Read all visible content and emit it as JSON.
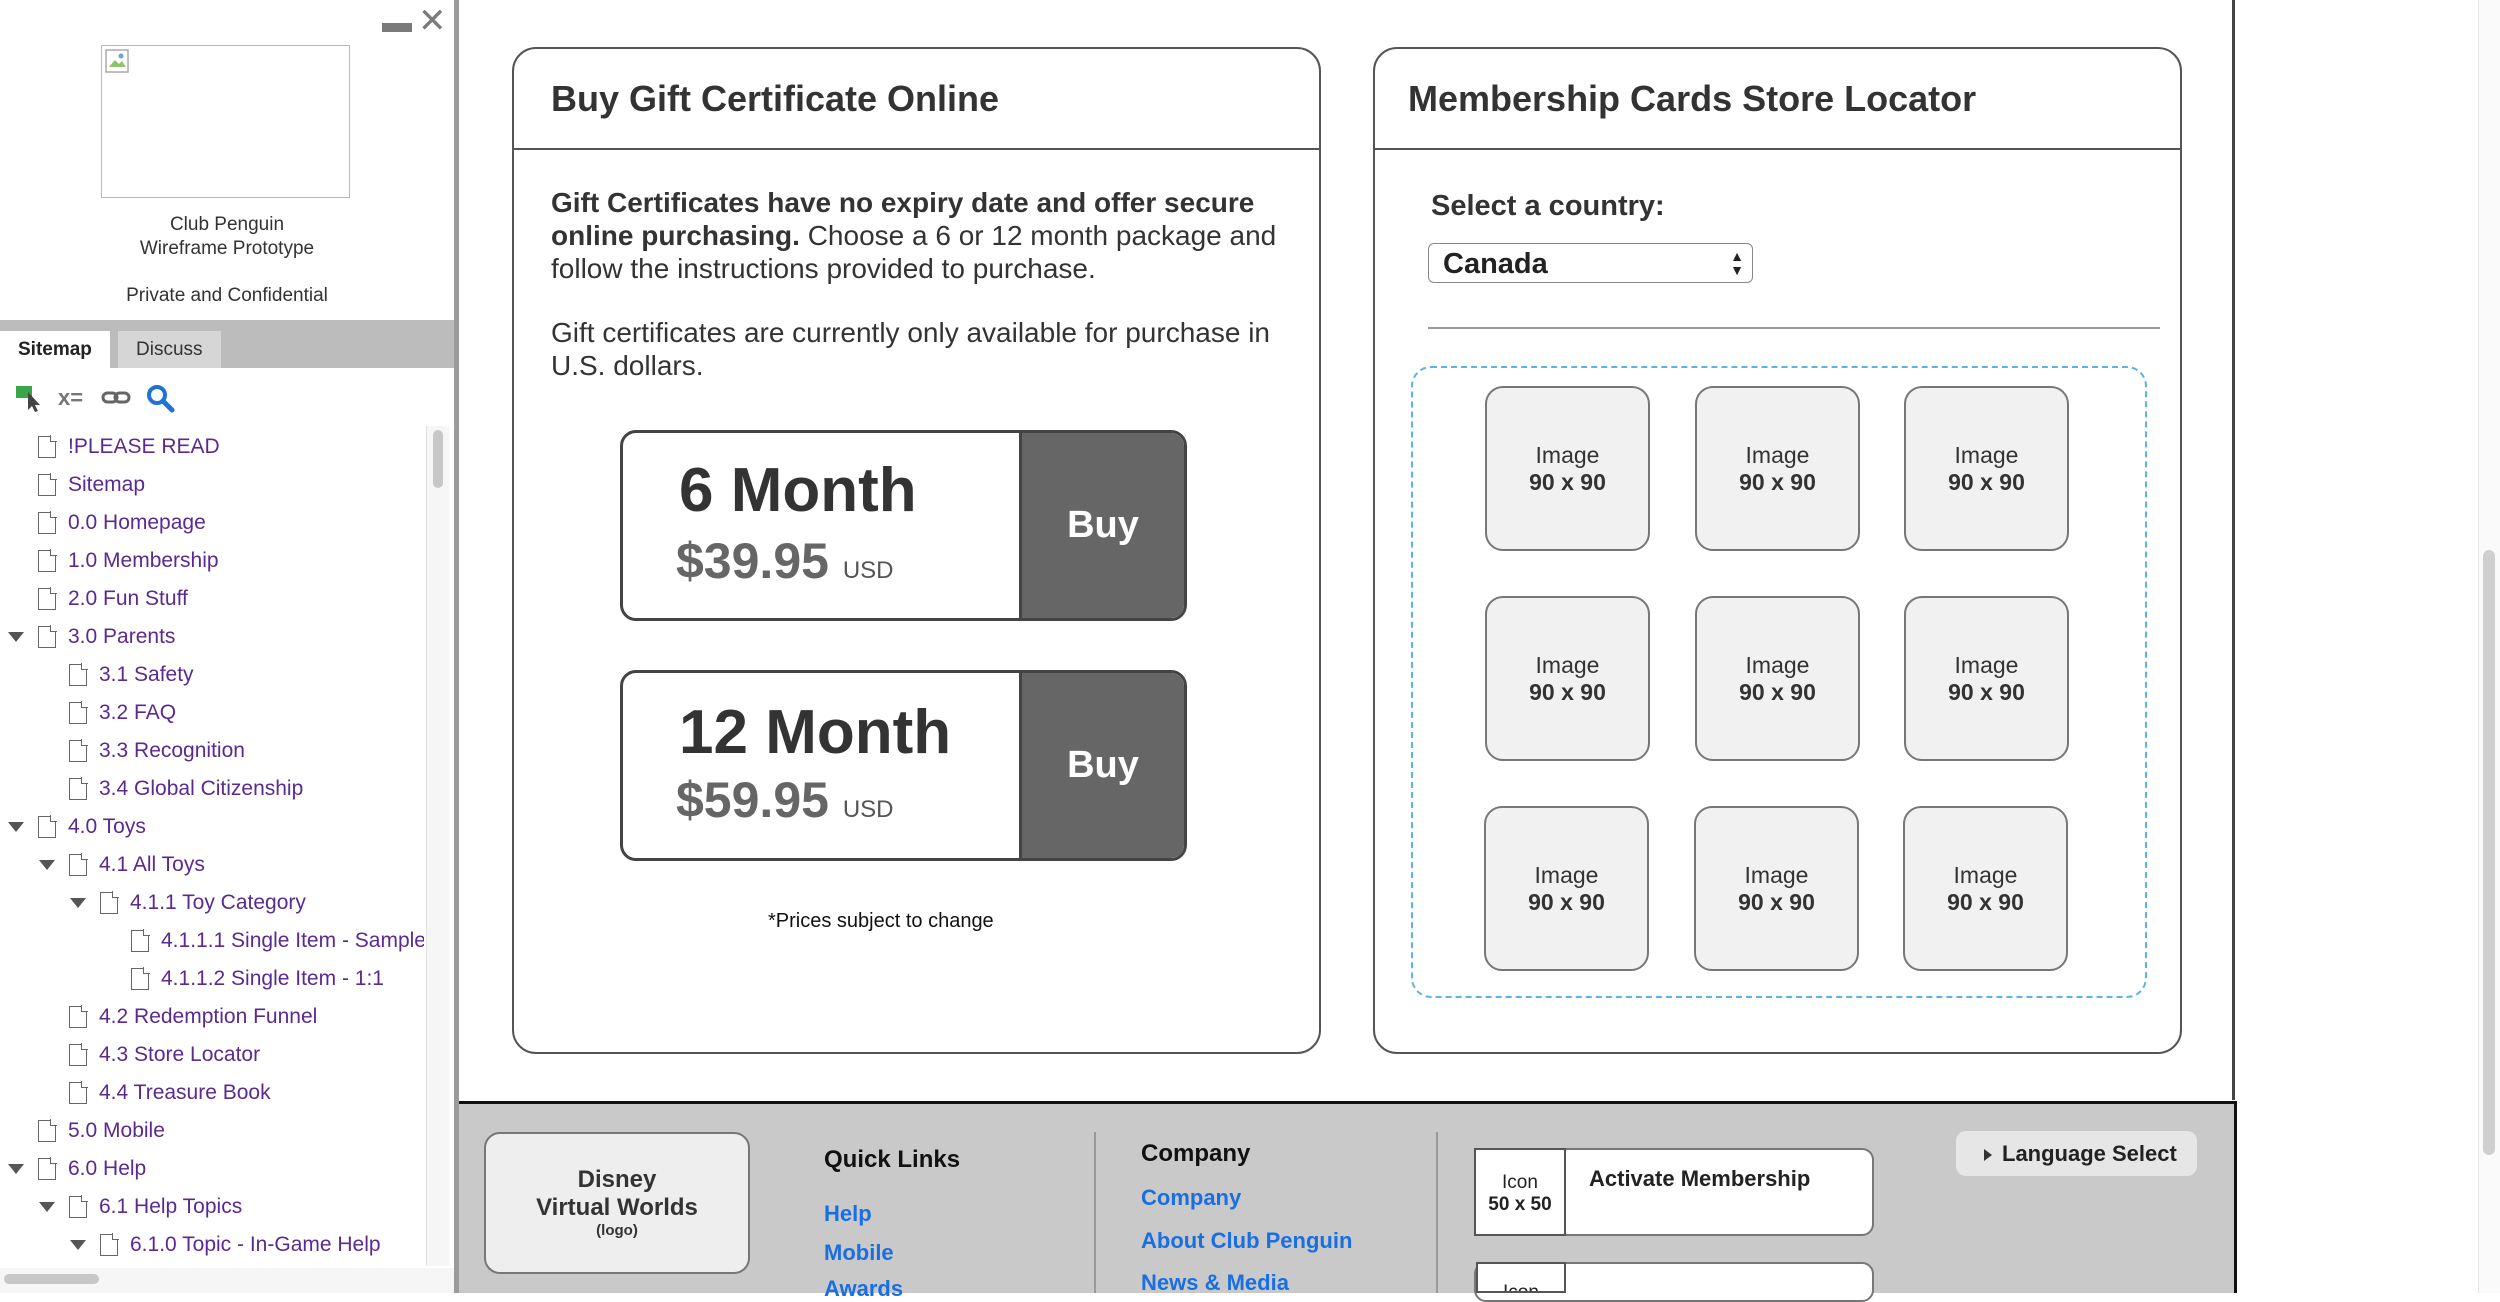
{
  "sidebar": {
    "caption": {
      "line1": "Club Penguin",
      "line2": "Wireframe Prototype",
      "line3": "Private and Confidential"
    },
    "tabs": {
      "sitemap": "Sitemap",
      "discuss": "Discuss"
    },
    "toolbar": {
      "vars_label": "x="
    },
    "tree": [
      {
        "label": "!PLEASE READ"
      },
      {
        "label": "Sitemap"
      },
      {
        "label": "0.0 Homepage"
      },
      {
        "label": "1.0 Membership"
      },
      {
        "label": "2.0 Fun Stuff"
      },
      {
        "label": "3.0 Parents"
      },
      {
        "label": "3.1 Safety"
      },
      {
        "label": "3.2 FAQ"
      },
      {
        "label": "3.3 Recognition"
      },
      {
        "label": "3.4 Global Citizenship"
      },
      {
        "label": "4.0 Toys"
      },
      {
        "label": "4.1 All Toys"
      },
      {
        "label": "4.1.1 Toy Category"
      },
      {
        "label": "4.1.1.1 Single Item - Sample"
      },
      {
        "label": "4.1.1.2 Single Item - 1:1"
      },
      {
        "label": "4.2 Redemption Funnel"
      },
      {
        "label": "4.3 Store Locator"
      },
      {
        "label": "4.4 Treasure Book"
      },
      {
        "label": "5.0 Mobile"
      },
      {
        "label": "6.0 Help"
      },
      {
        "label": "6.1 Help Topics"
      },
      {
        "label": "6.1.0 Topic - In-Game Help"
      }
    ]
  },
  "gift": {
    "title": "Buy Gift Certificate Online",
    "desc_bold": "Gift Certificates have no expiry date and offer secure online purchasing.",
    "desc_rest": " Choose a 6 or 12 month package and follow the instructions provided to purchase.",
    "desc2": "Gift certificates are currently only available for purchase in U.S. dollars.",
    "packages": [
      {
        "name": "6 Month",
        "price": "$39.95",
        "currency": "USD",
        "button": "Buy"
      },
      {
        "name": "12 Month",
        "price": "$59.95",
        "currency": "USD",
        "button": "Buy"
      }
    ],
    "note": "*Prices subject to change"
  },
  "store": {
    "title": "Membership Cards Store Locator",
    "country_label": "Select a country:",
    "country_value": "Canada",
    "placeholder_line1": "Image",
    "placeholder_line2": "90 x 90"
  },
  "footer": {
    "logo_line1": "Disney",
    "logo_line2": "Virtual Worlds",
    "logo_line3": "(logo)",
    "quick_links": {
      "heading": "Quick Links",
      "links": [
        "Help",
        "Mobile",
        "Awards"
      ]
    },
    "company": {
      "heading": "Company",
      "links": [
        "Company",
        "About Club Penguin",
        "News & Media"
      ]
    },
    "activate": {
      "icon_line1": "Icon",
      "icon_line2": "50 x 50",
      "label": "Activate Membership",
      "icon2_line1": "Icon"
    },
    "language_select": "Language Select"
  }
}
